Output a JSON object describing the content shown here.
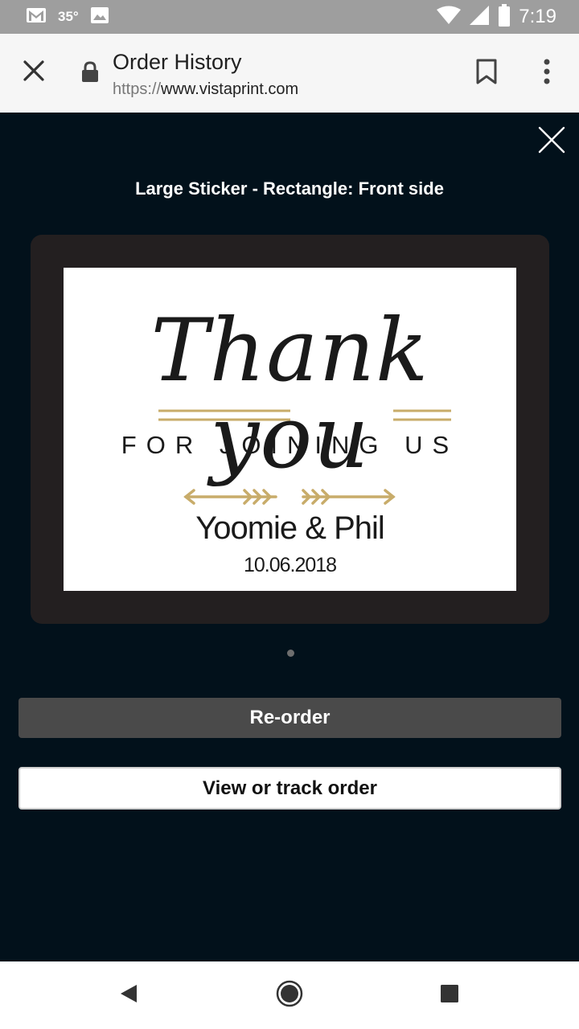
{
  "status_bar": {
    "temperature": "35°",
    "time": "7:19",
    "icons": [
      "gmail-icon",
      "image-icon",
      "wifi-icon",
      "signal-icon",
      "battery-icon"
    ]
  },
  "browser": {
    "page_title": "Order History",
    "url_scheme": "https://",
    "url_host": "www.vistaprint.com"
  },
  "modal": {
    "product_title": "Large Sticker - Rectangle: Front side",
    "sticker": {
      "headline": "Thank you",
      "subtitle": "FOR JOINING US",
      "names": "Yoomie & Phil",
      "date": "10.06.2018"
    },
    "page_count": 1,
    "reorder_label": "Re-order",
    "track_label": "View or track order"
  },
  "colors": {
    "background": "#02111b",
    "frame": "#231f20",
    "gold_accent": "#c8ac6a",
    "reorder_button": "#4a4a4a"
  }
}
